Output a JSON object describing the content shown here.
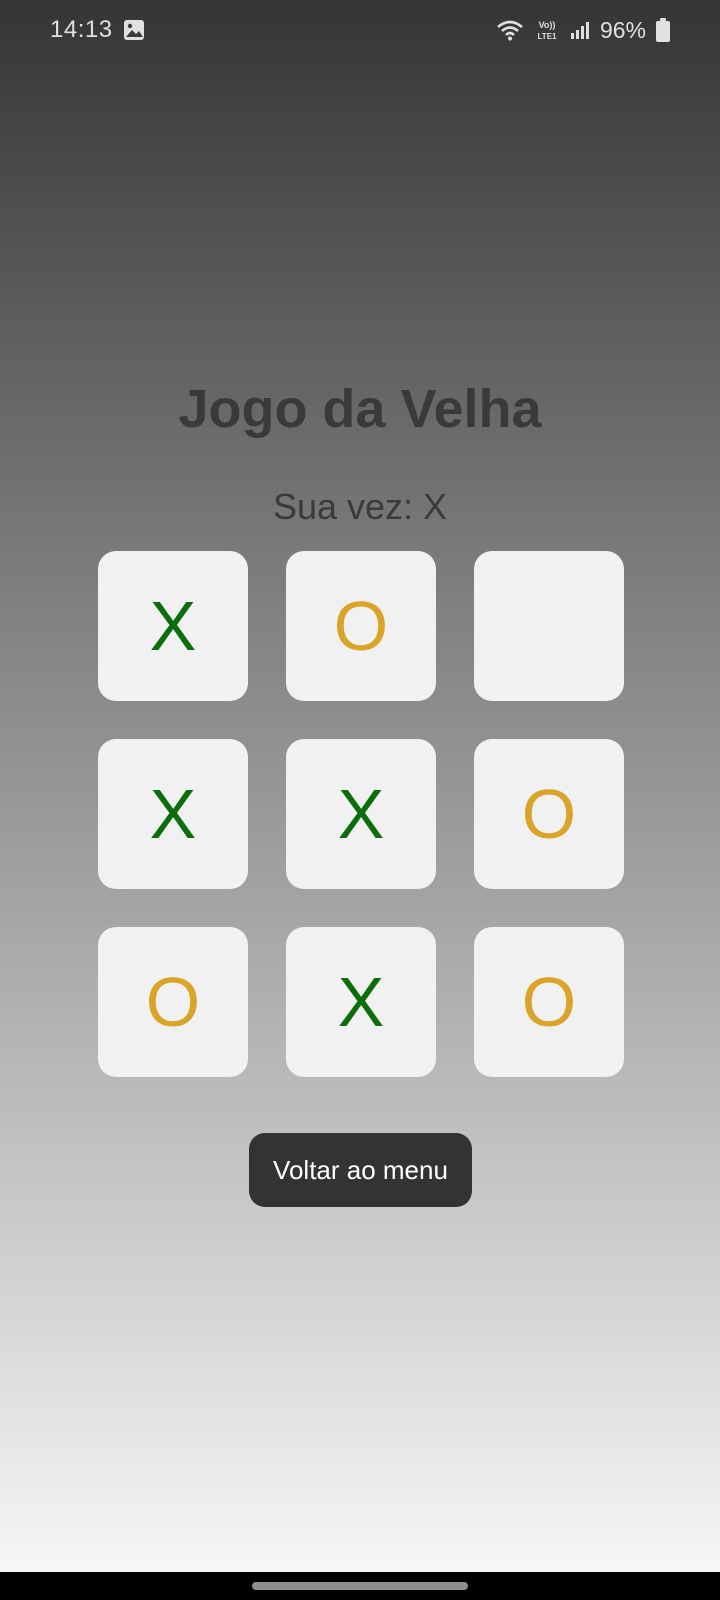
{
  "status_bar": {
    "time": "14:13",
    "notification_icon": "image-icon",
    "wifi_icon": "wifi-icon",
    "volte_label": "Vo)) LTE1",
    "signal_icon": "signal-icon",
    "battery_percent": "96%",
    "battery_icon": "battery-icon"
  },
  "game": {
    "title": "Jogo da Velha",
    "turn_text": "Sua vez: X",
    "board": [
      "X",
      "O",
      "",
      "X",
      "X",
      "O",
      "O",
      "X",
      "O"
    ]
  },
  "actions": {
    "back_to_menu_label": "Voltar ao menu"
  },
  "colors": {
    "x_mark": "#0b6e0b",
    "o_mark": "#d9a427",
    "cell_bg": "#f1f1f1",
    "button_bg": "#333333"
  }
}
